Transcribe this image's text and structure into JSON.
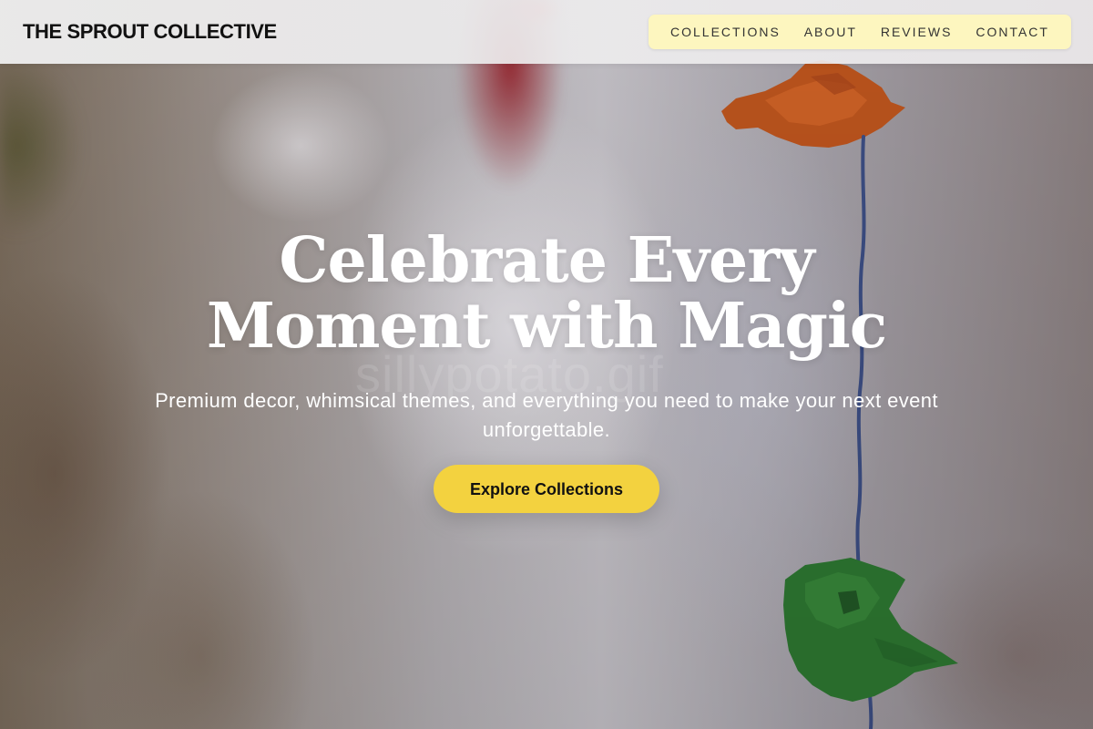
{
  "header": {
    "brand": "THE SPROUT COLLECTIVE",
    "nav": {
      "items": [
        "COLLECTIONS",
        "ABOUT",
        "REVIEWS",
        "CONTACT"
      ]
    }
  },
  "hero": {
    "title": "Celebrate Every Moment with Magic",
    "subtitle": "Premium decor, whimsical themes, and everything you need to make your next event unforgettable.",
    "cta_label": "Explore Collections",
    "watermark": "sillypotato.gif"
  },
  "colors": {
    "nav_background": "#fdf6bf",
    "cta_background": "#f3d23f",
    "hero_text": "#ffffff",
    "brand_text": "#111111"
  }
}
